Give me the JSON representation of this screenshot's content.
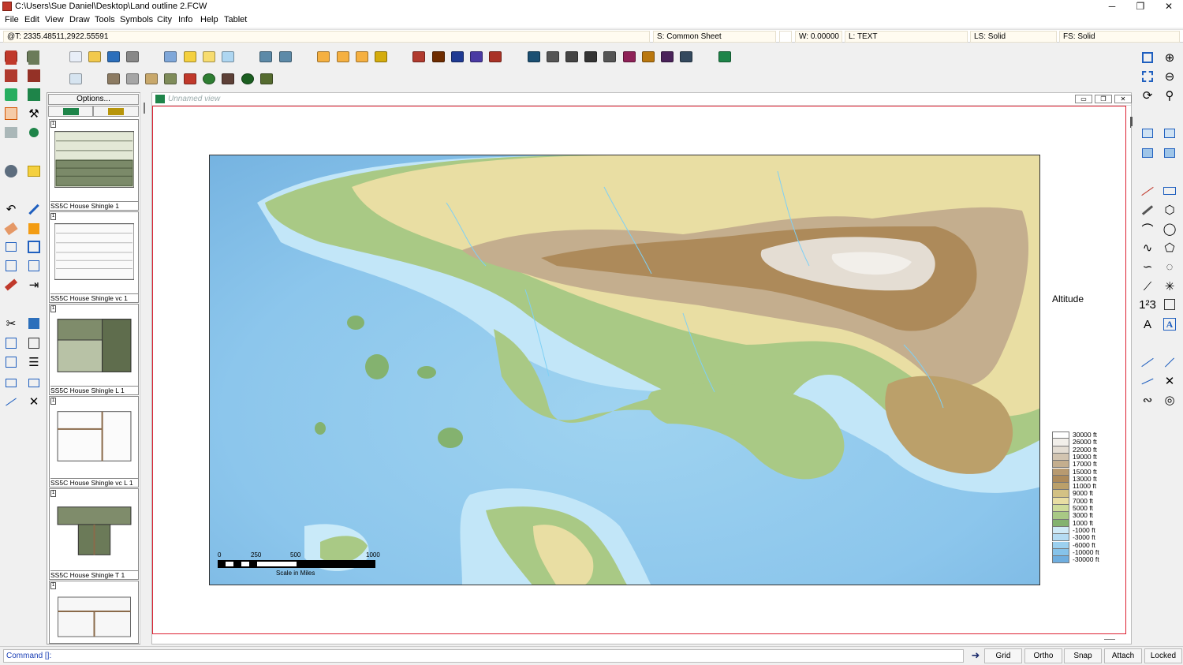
{
  "window": {
    "title": "C:\\Users\\Sue Daniel\\Desktop\\Land outline 2.FCW",
    "minimize_glyph": "─",
    "maximize_glyph": "❐",
    "close_glyph": "✕"
  },
  "menu": [
    "File",
    "Edit",
    "View",
    "Draw",
    "Tools",
    "Symbols",
    "City",
    "Info",
    "Help",
    "Tablet"
  ],
  "infobar": {
    "coords": "@T: 2335.48511,2922.55591",
    "sheet": "S: Common Sheet",
    "width": "W: 0.00000",
    "layer": "L: TEXT",
    "line_style": "LS: Solid",
    "fill_style": "FS: Solid"
  },
  "catalog": {
    "options_label": "Options...",
    "items": [
      {
        "label": "SS5C House Shingle 1",
        "num": "1"
      },
      {
        "label": "SS5C House Shingle vc 1",
        "num": "1"
      },
      {
        "label": "SS5C House Shingle L 1",
        "num": "1"
      },
      {
        "label": "SS5C House Shingle vc L 1",
        "num": "1"
      },
      {
        "label": "SS5C House Shingle T 1",
        "num": "1"
      },
      {
        "label": "",
        "num": "1"
      }
    ]
  },
  "view": {
    "title": "Unnamed view"
  },
  "map": {
    "legend_title": "Altitude",
    "legend": [
      {
        "label": "30000 ft",
        "color": "#ffffff"
      },
      {
        "label": "26000 ft",
        "color": "#f2efea"
      },
      {
        "label": "22000 ft",
        "color": "#e4ddd3"
      },
      {
        "label": "19000 ft",
        "color": "#d2c4b0"
      },
      {
        "label": "17000 ft",
        "color": "#c4ae8e"
      },
      {
        "label": "15000 ft",
        "color": "#b89a70"
      },
      {
        "label": "13000 ft",
        "color": "#ad8a5a"
      },
      {
        "label": "11000 ft",
        "color": "#bba06a"
      },
      {
        "label": "9000 ft",
        "color": "#d3c184"
      },
      {
        "label": "7000 ft",
        "color": "#e9dea3"
      },
      {
        "label": "5000 ft",
        "color": "#cfdc9a"
      },
      {
        "label": "3000 ft",
        "color": "#a9c985"
      },
      {
        "label": "1000 ft",
        "color": "#84b26f"
      },
      {
        "label": "-1000 ft",
        "color": "#cfeaf7"
      },
      {
        "label": "-3000 ft",
        "color": "#b5dcf3"
      },
      {
        "label": "-6000 ft",
        "color": "#9cd0ef"
      },
      {
        "label": "-10000 ft",
        "color": "#86c3ea"
      },
      {
        "label": "-30000 ft",
        "color": "#6faedf"
      }
    ],
    "scale": {
      "ticks": [
        "0",
        "250",
        "500",
        "1000"
      ],
      "caption": "Scale in Miles"
    }
  },
  "statusbar": {
    "command": "Command []:",
    "buttons": [
      "Grid",
      "Ortho",
      "Snap",
      "Attach",
      "Locked"
    ]
  }
}
